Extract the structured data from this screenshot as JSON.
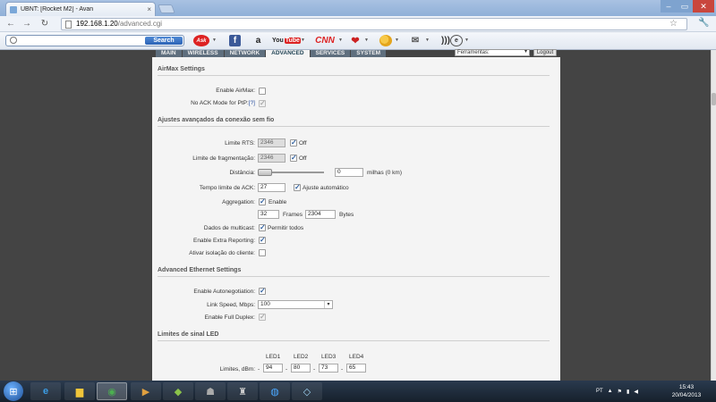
{
  "browser": {
    "tab_title": "UBNT: [Rocket M2] - Avan",
    "tab_close": "×",
    "url_host": "192.168.1.20",
    "url_path": "/advanced.cgi"
  },
  "toolbar": {
    "search_placeholder": "",
    "search_button": "Search",
    "icons": [
      "ask-icon",
      "facebook-icon",
      "amazon-icon",
      "youtube-icon",
      "cnn-icon",
      "heart-icon",
      "weather-icon",
      "mail-icon",
      "radio-icon",
      "globe-icon"
    ],
    "ask_label": "Ask",
    "amazon_label": "a",
    "youtube_label": "You",
    "youtube_tube": "Tube",
    "cnn_label": "CNN"
  },
  "ubnt": {
    "tabs": [
      "MAIN",
      "WIRELESS",
      "NETWORK",
      "ADVANCED",
      "SERVICES",
      "SYSTEM"
    ],
    "active_tab": "ADVANCED",
    "tools_select": "Ferramentas:",
    "logout_button": "Logout"
  },
  "airmax": {
    "title": "AirMax Settings",
    "enable_label": "Enable AirMax:",
    "enable_checked": false,
    "noack_label": "No ACK Mode for PtP:",
    "noack_help": "[?]",
    "noack_checked": true
  },
  "wireless_adv": {
    "title": "Ajustes avançados da conexão sem fio",
    "rts_label": "Limite RTS:",
    "rts_value": "2346",
    "rts_off_label": "Off",
    "rts_off_checked": true,
    "frag_label": "Limite de fragmentação:",
    "frag_value": "2346",
    "frag_off_label": "Off",
    "frag_off_checked": true,
    "distance_label": "Distância:",
    "distance_value": "0",
    "distance_unit": "milhas (0 km)",
    "distance_slider": 0,
    "ack_label": "Tempo limite de ACK:",
    "ack_value": "27",
    "ack_auto_label": "Ajuste automático",
    "ack_auto_checked": true,
    "aggregation_label": "Aggregation:",
    "aggregation_enable_label": "Enable",
    "aggregation_checked": true,
    "agg_frames_value": "32",
    "agg_frames_label": "Frames",
    "agg_bytes_value": "2304",
    "agg_bytes_label": "Bytes",
    "multicast_label": "Dados de multicast:",
    "multicast_allow_label": "Permitir todos",
    "multicast_checked": true,
    "extra_label": "Enable Extra Reporting:",
    "extra_checked": true,
    "isolation_label": "Ativar isolação do cliente:",
    "isolation_checked": false
  },
  "ethernet": {
    "title": "Advanced Ethernet Settings",
    "autoneg_label": "Enable Autonegotiation:",
    "autoneg_checked": true,
    "speed_label": "Link Speed, Mbps:",
    "speed_value": "100",
    "duplex_label": "Enable Full Duplex:",
    "duplex_checked": true
  },
  "led": {
    "title": "Limites de sinal LED",
    "headers": [
      "LED1",
      "LED2",
      "LED3",
      "LED4"
    ],
    "limits_label": "Limites, dBm:",
    "values": [
      "94",
      "80",
      "73",
      "65"
    ],
    "sep": "-"
  },
  "taskbar": {
    "lang": "PT",
    "time": "15:43",
    "date": "20/04/2013"
  }
}
